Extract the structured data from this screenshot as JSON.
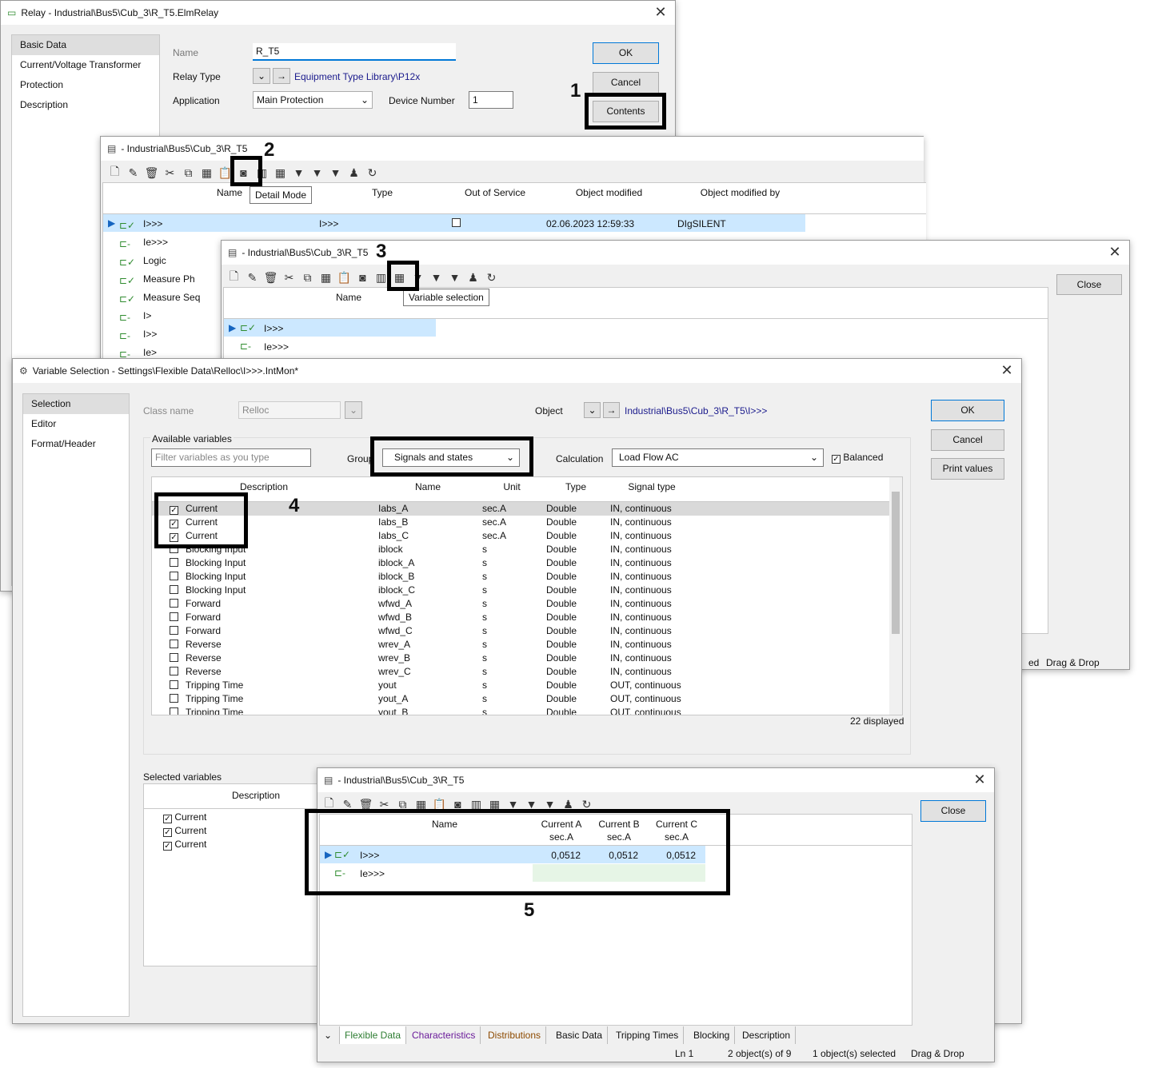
{
  "relay": {
    "title": "Relay - Industrial\\Bus5\\Cub_3\\R_T5.ElmRelay",
    "nav": [
      "Basic Data",
      "Current/Voltage Transformer",
      "Protection",
      "Description"
    ],
    "name_label": "Name",
    "name_value": "R_T5",
    "relay_type_label": "Relay Type",
    "relay_type_value": "Equipment Type Library\\P12x",
    "application_label": "Application",
    "application_value": "Main Protection",
    "device_number_label": "Device Number",
    "device_number_value": "1",
    "ok": "OK",
    "cancel": "Cancel",
    "contents": "Contents"
  },
  "browser1": {
    "title": "- Industrial\\Bus5\\Cub_3\\R_T5",
    "tooltip": "Detail Mode",
    "columns": [
      "Name",
      "Type",
      "Out of Service",
      "Object modified",
      "Object modified by"
    ],
    "rows": [
      {
        "name": "I>>>",
        "type": "I>>>",
        "modified": "02.06.2023 12:59:33",
        "by": "DIgSILENT"
      },
      {
        "name": "Ie>>>"
      },
      {
        "name": "Logic"
      },
      {
        "name": "Measure Ph"
      },
      {
        "name": "Measure Seq"
      },
      {
        "name": "I>"
      },
      {
        "name": "I>>"
      },
      {
        "name": "Ie>"
      }
    ],
    "status_tail": "ed",
    "drag_drop": "Drag & Drop"
  },
  "browser2": {
    "title": "- Industrial\\Bus5\\Cub_3\\R_T5",
    "tooltip": "Variable selection",
    "close": "Close",
    "col_name": "Name",
    "rows": [
      "I>>>",
      "Ie>>>"
    ]
  },
  "varsel": {
    "title": "Variable Selection - Settings\\Flexible Data\\Relloc\\I>>>.IntMon*",
    "nav": [
      "Selection",
      "Editor",
      "Format/Header"
    ],
    "class_name_label": "Class name",
    "class_name_value": "Relloc",
    "object_label": "Object",
    "object_value": "Industrial\\Bus5\\Cub_3\\R_T5\\I>>>",
    "ok": "OK",
    "cancel": "Cancel",
    "print_values": "Print values",
    "available_label": "Available variables",
    "filter_placeholder": "Filter variables as you type",
    "group_label": "Group",
    "group_value": "Signals and states",
    "calculation_label": "Calculation",
    "calculation_value": "Load Flow AC",
    "balanced_label": "Balanced",
    "columns": [
      "Description",
      "Name",
      "Unit",
      "Type",
      "Signal type"
    ],
    "rows": [
      [
        "Current",
        "Iabs_A",
        "sec.A",
        "Double",
        "IN, continuous",
        true
      ],
      [
        "Current",
        "Iabs_B",
        "sec.A",
        "Double",
        "IN, continuous",
        true
      ],
      [
        "Current",
        "Iabs_C",
        "sec.A",
        "Double",
        "IN, continuous",
        true
      ],
      [
        "Blocking Input",
        "iblock",
        "s",
        "Double",
        "IN, continuous",
        false
      ],
      [
        "Blocking Input",
        "iblock_A",
        "s",
        "Double",
        "IN, continuous",
        false
      ],
      [
        "Blocking Input",
        "iblock_B",
        "s",
        "Double",
        "IN, continuous",
        false
      ],
      [
        "Blocking Input",
        "iblock_C",
        "s",
        "Double",
        "IN, continuous",
        false
      ],
      [
        "Forward",
        "wfwd_A",
        "s",
        "Double",
        "IN, continuous",
        false
      ],
      [
        "Forward",
        "wfwd_B",
        "s",
        "Double",
        "IN, continuous",
        false
      ],
      [
        "Forward",
        "wfwd_C",
        "s",
        "Double",
        "IN, continuous",
        false
      ],
      [
        "Reverse",
        "wrev_A",
        "s",
        "Double",
        "IN, continuous",
        false
      ],
      [
        "Reverse",
        "wrev_B",
        "s",
        "Double",
        "IN, continuous",
        false
      ],
      [
        "Reverse",
        "wrev_C",
        "s",
        "Double",
        "IN, continuous",
        false
      ],
      [
        "Tripping Time",
        "yout",
        "s",
        "Double",
        "OUT, continuous",
        false
      ],
      [
        "Tripping Time",
        "yout_A",
        "s",
        "Double",
        "OUT, continuous",
        false
      ],
      [
        "Tripping Time",
        "yout_B",
        "s",
        "Double",
        "OUT, continuous",
        false
      ]
    ],
    "displayed": "22 displayed",
    "selected_label": "Selected variables",
    "selected_col": "Description",
    "selected": [
      "Current",
      "Current",
      "Current"
    ]
  },
  "browser3": {
    "title": "- Industrial\\Bus5\\Cub_3\\R_T5",
    "close": "Close",
    "columns": [
      {
        "l1": "Name",
        "l2": ""
      },
      {
        "l1": "Current A",
        "l2": "sec.A"
      },
      {
        "l1": "Current B",
        "l2": "sec.A"
      },
      {
        "l1": "Current C",
        "l2": "sec.A"
      }
    ],
    "rows": [
      {
        "name": "I>>>",
        "a": "0,0512",
        "b": "0,0512",
        "c": "0,0512"
      },
      {
        "name": "Ie>>>",
        "a": "",
        "b": "",
        "c": ""
      }
    ],
    "tabs": [
      "Flexible Data",
      "Characteristics",
      "Distributions",
      "Basic Data",
      "Tripping Times",
      "Blocking",
      "Description"
    ],
    "status": [
      "Ln 1",
      "2 object(s) of 9",
      "1 object(s) selected",
      "Drag & Drop"
    ]
  },
  "callouts": [
    "1",
    "2",
    "3",
    "4",
    "5"
  ],
  "colors": {
    "selected_row": "#cce8ff",
    "highlight": "#000000",
    "link": "#1a1a8c",
    "green_icon": "#2e8b2e",
    "empty_cell": "#e6f5e6"
  }
}
